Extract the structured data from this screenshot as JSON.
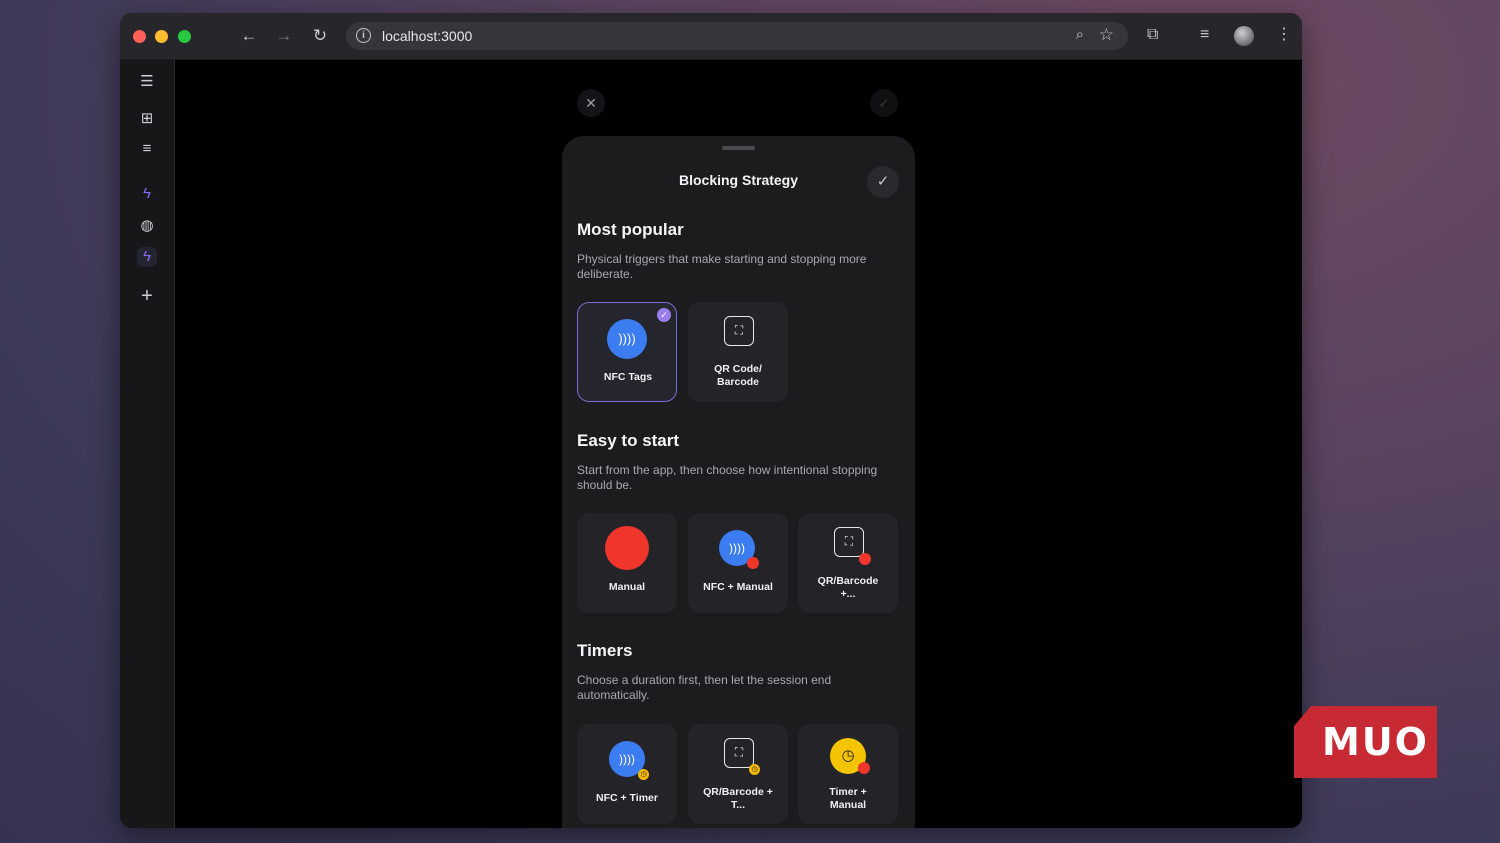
{
  "browser": {
    "url": "localhost:3000"
  },
  "sheet": {
    "title": "Blocking Strategy"
  },
  "sections": {
    "popular": {
      "title": "Most popular",
      "desc": "Physical triggers that make starting and stopping more deliberate.",
      "cards": {
        "nfc": "NFC Tags",
        "qr_line1": "QR Code/",
        "qr_line2": "Barcode"
      }
    },
    "easy": {
      "title": "Easy to start",
      "desc": "Start from the app, then choose how intentional stopping should be.",
      "cards": {
        "manual": "Manual",
        "nfc_manual": "NFC + Manual",
        "qr_line1": "QR/Barcode",
        "qr_line2": "+..."
      }
    },
    "timers": {
      "title": "Timers",
      "desc": "Choose a duration first, then let the session end automatically.",
      "cards": {
        "nfc_timer": "NFC + Timer",
        "qr_timer_line1": "QR/Barcode +",
        "qr_timer_line2": "T...",
        "timer_manual_line1": "Timer +",
        "timer_manual_line2": "Manual"
      }
    }
  },
  "watermark": {
    "text": "MUO"
  },
  "colors": {
    "accent": "#7d6bd8",
    "nfc_blue": "#3b7cf0",
    "manual_red": "#f0352b",
    "timer_yellow": "#f5c400"
  },
  "icons": {
    "sidebar": [
      "sidebar-toggle-icon",
      "grid-icon",
      "search-list-icon",
      "bolt-icon",
      "globe-icon",
      "bolt-icon",
      "plus-icon"
    ],
    "toolbar": [
      "back-icon",
      "forward-icon",
      "reload-icon",
      "info-icon",
      "zoom-icon",
      "star-icon",
      "extensions-icon",
      "media-icon",
      "profile-icon",
      "menu-icon"
    ]
  }
}
